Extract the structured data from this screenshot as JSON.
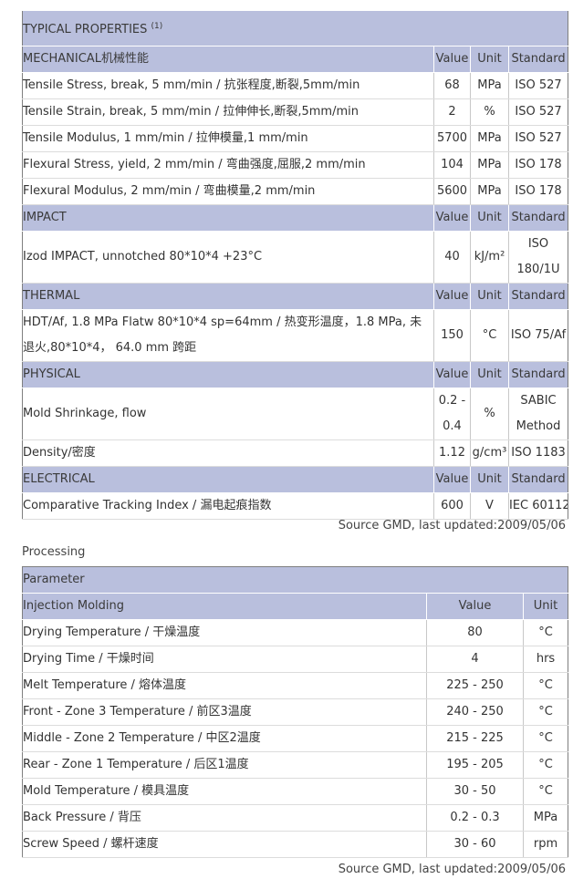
{
  "properties": {
    "title": "TYPICAL PROPERTIES",
    "title_sup": "(1)",
    "columns": {
      "value": "Value",
      "unit": "Unit",
      "standard": "Standard"
    },
    "sections": [
      {
        "name": "MECHANICAL机械性能",
        "rows": [
          {
            "label": "Tensile Stress, break, 5 mm/min / 抗张程度,断裂,5mm/min",
            "value": "68",
            "unit": "MPa",
            "standard": "ISO 527"
          },
          {
            "label": "Tensile Strain, break, 5 mm/min / 拉伸伸长,断裂,5mm/min",
            "value": "2",
            "unit": "%",
            "standard": "ISO 527"
          },
          {
            "label": "Tensile Modulus, 1 mm/min / 拉伸模量,1 mm/min",
            "value": "5700",
            "unit": "MPa",
            "standard": "ISO 527"
          },
          {
            "label": "Flexural Stress, yield, 2 mm/min / 弯曲强度,屈服,2 mm/min",
            "value": "104",
            "unit": "MPa",
            "standard": "ISO 178"
          },
          {
            "label": "Flexural Modulus, 2 mm/min / 弯曲模量,2 mm/min",
            "value": "5600",
            "unit": "MPa",
            "standard": "ISO 178"
          }
        ]
      },
      {
        "name": "IMPACT",
        "rows": [
          {
            "label": "Izod IMPACT, unnotched 80*10*4 +23°C",
            "value": "40",
            "unit": "kJ/m²",
            "standard": "ISO 180/1U"
          }
        ]
      },
      {
        "name": "THERMAL",
        "rows": [
          {
            "label": "HDT/Af, 1.8 MPa Flatw 80*10*4 sp=64mm / 热变形温度，1.8 MPa, 未退火,80*10*4， 64.0 mm 跨距",
            "value": "150",
            "unit": "°C",
            "standard": "ISO 75/Af"
          }
        ]
      },
      {
        "name": "PHYSICAL",
        "rows": [
          {
            "label": "Mold Shrinkage, flow",
            "value": "0.2 - 0.4",
            "unit": "%",
            "standard": "SABIC Method"
          },
          {
            "label": "Density/密度",
            "value": "1.12",
            "unit": "g/cm³",
            "standard": "ISO 1183"
          }
        ]
      },
      {
        "name": "ELECTRICAL",
        "rows": [
          {
            "label": "Comparative Tracking Index / 漏电起痕指数",
            "value": "600",
            "unit": "V",
            "standard": "IEC 60112"
          }
        ]
      }
    ],
    "source": "Source GMD, last updated:2009/05/06"
  },
  "processing": {
    "title": "Processing",
    "parameter": "Parameter",
    "section": "Injection Molding",
    "columns": {
      "value": "Value",
      "unit": "Unit"
    },
    "rows": [
      {
        "label": "Drying Temperature / 干燥温度",
        "value": "80",
        "unit": "°C"
      },
      {
        "label": "Drying Time / 干燥时间",
        "value": "4",
        "unit": "hrs"
      },
      {
        "label": "Melt Temperature / 熔体温度",
        "value": "225 - 250",
        "unit": "°C"
      },
      {
        "label": "Front - Zone 3 Temperature / 前区3温度",
        "value": "240 - 250",
        "unit": "°C"
      },
      {
        "label": "Middle - Zone 2 Temperature / 中区2温度",
        "value": "215 - 225",
        "unit": "°C"
      },
      {
        "label": "Rear - Zone 1 Temperature / 后区1温度",
        "value": "195 - 205",
        "unit": "°C"
      },
      {
        "label": "Mold Temperature / 模具温度",
        "value": "30 - 50",
        "unit": "°C"
      },
      {
        "label": "Back Pressure / 背压",
        "value": "0.2 - 0.3",
        "unit": "MPa"
      },
      {
        "label": "Screw Speed / 螺杆速度",
        "value": "30 - 60",
        "unit": "rpm"
      }
    ],
    "source": "Source GMD, last updated:2009/05/06"
  }
}
